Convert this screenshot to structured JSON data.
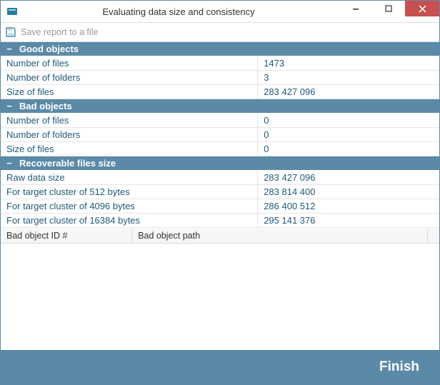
{
  "window": {
    "title": "Evaluating data size and consistency"
  },
  "toolbar": {
    "save_label": "Save report to a file"
  },
  "sections": {
    "good": {
      "title": "Good objects",
      "rows": {
        "num_files_label": "Number of files",
        "num_files_value": "1473",
        "num_folders_label": "Number of folders",
        "num_folders_value": "3",
        "size_files_label": "Size of files",
        "size_files_value": "283 427 096"
      }
    },
    "bad": {
      "title": "Bad objects",
      "rows": {
        "num_files_label": "Number of files",
        "num_files_value": "0",
        "num_folders_label": "Number of folders",
        "num_folders_value": "0",
        "size_files_label": "Size of files",
        "size_files_value": "0"
      }
    },
    "recoverable": {
      "title": "Recoverable files size",
      "rows": {
        "raw_label": "Raw data size",
        "raw_value": "283 427 096",
        "c512_label": "For target cluster of 512 bytes",
        "c512_value": "283 814 400",
        "c4096_label": "For target cluster of 4096 bytes",
        "c4096_value": "286 400 512",
        "c16384_label": "For target cluster of 16384 bytes",
        "c16384_value": "295 141 376"
      }
    }
  },
  "grid": {
    "col_id": "Bad object ID #",
    "col_path": "Bad object path"
  },
  "footer": {
    "finish": "Finish"
  },
  "collapse_glyph": "−"
}
